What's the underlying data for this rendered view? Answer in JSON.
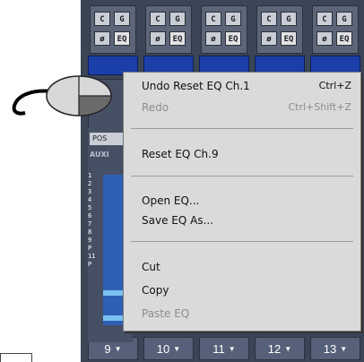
{
  "strips": [
    {
      "c": "C",
      "g": "G",
      "phase": "ø",
      "eq": "EQ",
      "num": "9"
    },
    {
      "c": "C",
      "g": "G",
      "phase": "ø",
      "eq": "EQ",
      "num": "10"
    },
    {
      "c": "C",
      "g": "G",
      "phase": "ø",
      "eq": "EQ",
      "num": "11"
    },
    {
      "c": "C",
      "g": "G",
      "phase": "ø",
      "eq": "EQ",
      "num": "12"
    },
    {
      "c": "C",
      "g": "G",
      "phase": "ø",
      "eq": "EQ",
      "num": "13"
    }
  ],
  "panel": {
    "pos": "POS",
    "aux": "AUXI",
    "aux_numbers": [
      "1",
      "2",
      "3",
      "4",
      "5",
      "6",
      "7",
      "8",
      "9",
      "P",
      "11",
      "P"
    ]
  },
  "menu": {
    "undo": {
      "label": "Undo Reset EQ Ch.1",
      "shortcut": "Ctrl+Z"
    },
    "redo": {
      "label": "Redo",
      "shortcut": "Ctrl+Shift+Z"
    },
    "reset": "Reset EQ Ch.9",
    "open": "Open EQ...",
    "save": "Save EQ As...",
    "cut": "Cut",
    "copy": "Copy",
    "paste": "Paste EQ"
  },
  "colors": {
    "mixer_bg": "#3a4556",
    "menu_bg": "#dadada",
    "display": "#1b3fa8"
  }
}
